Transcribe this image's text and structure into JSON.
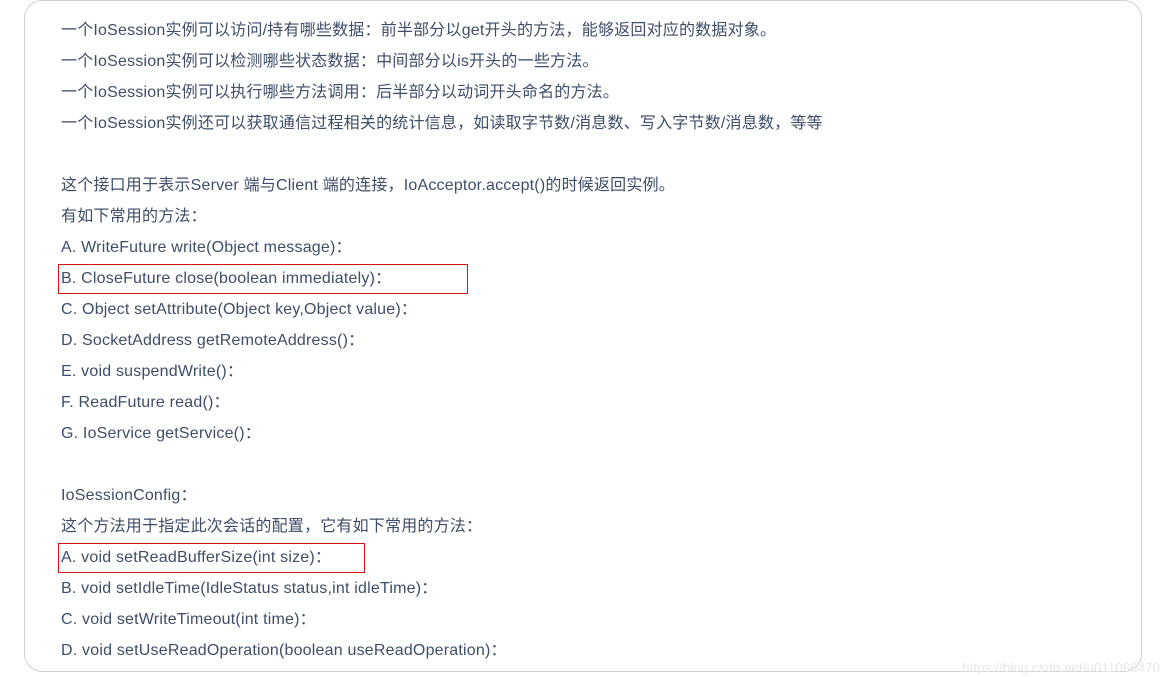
{
  "lines": {
    "l0": "一个IoSession实例可以访问/持有哪些数据：前半部分以get开头的方法，能够返回对应的数据对象。",
    "l1": "一个IoSession实例可以检测哪些状态数据：中间部分以is开头的一些方法。",
    "l2": "一个IoSession实例可以执行哪些方法调用：后半部分以动词开头命名的方法。",
    "l3": "一个IoSession实例还可以获取通信过程相关的统计信息，如读取字节数/消息数、写入字节数/消息数，等等",
    "l4": "这个接口用于表示Server 端与Client 端的连接，IoAcceptor.accept()的时候返回实例。",
    "l5": "有如下常用的方法：",
    "l6": "A. WriteFuture write(Object message)：",
    "l7": "B. CloseFuture close(boolean immediately)：",
    "l8": "C. Object setAttribute(Object key,Object value)：",
    "l9": "D. SocketAddress getRemoteAddress()：",
    "l10": "E. void suspendWrite()：",
    "l11": "F. ReadFuture read()：",
    "l12": "G. IoService getService()：",
    "l13": "IoSessionConfig：",
    "l14": "这个方法用于指定此次会话的配置，它有如下常用的方法：",
    "l15": "A. void setReadBufferSize(int size)：",
    "l16": "B. void setIdleTime(IdleStatus status,int idleTime)：",
    "l17": "C. void setWriteTimeout(int time)：",
    "l18": "D. void setUseReadOperation(boolean useReadOperation)："
  },
  "watermark": "https://blog.csdn.net/u011066470"
}
